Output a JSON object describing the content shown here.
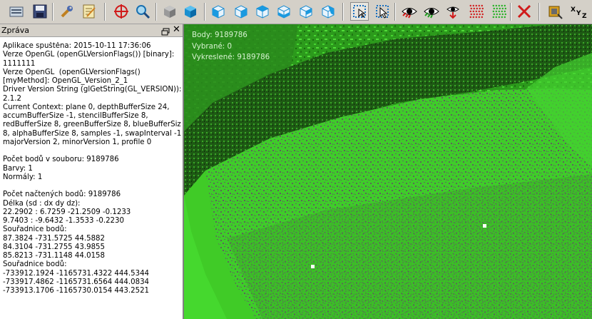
{
  "toolbar": {
    "buttons": [
      {
        "name": "open-file-icon"
      },
      {
        "name": "save-file-icon"
      },
      {
        "name": "settings-wrench-icon"
      },
      {
        "name": "edit-notes-icon"
      },
      {
        "name": "target-icon"
      },
      {
        "name": "zoom-icon"
      },
      {
        "name": "gray-cube-icon"
      },
      {
        "name": "blue-cube-icon"
      },
      {
        "name": "view-front-icon"
      },
      {
        "name": "view-back-icon"
      },
      {
        "name": "view-left-icon"
      },
      {
        "name": "view-right-icon"
      },
      {
        "name": "view-top-icon"
      },
      {
        "name": "view-bottom-icon"
      },
      {
        "name": "rect-select-icon"
      },
      {
        "name": "pointer-select-icon"
      },
      {
        "name": "show-red-eye-icon"
      },
      {
        "name": "show-green-eye-icon"
      },
      {
        "name": "eye-down-icon"
      },
      {
        "name": "red-points-icon"
      },
      {
        "name": "green-points-icon"
      },
      {
        "name": "clear-x-icon"
      },
      {
        "name": "measure-icon"
      },
      {
        "name": "xyz-axes-icon"
      }
    ],
    "xyz_label": "XYZ"
  },
  "panel": {
    "title": "Zpráva",
    "close_symbol": "✕",
    "log_lines": [
      "Aplikace spuštěna: 2015-10-11 17:36:06",
      "Verze OpenGL (openGLVersionFlags()) [binary]:",
      "1111111",
      "Verze OpenGL  (openGLVersionFlags()",
      "[myMethod]: OpenGL_Version_2_1",
      "Driver Version String (glGetString(GL_VERSION)):",
      "2.1.2",
      "Current Context: plane 0, depthBufferSize 24,",
      "accumBufferSize -1, stencilBufferSize 8,",
      "redBufferSize 8, greenBufferSize 8, blueBufferSize",
      "8, alphaBufferSize 8, samples -1, swapInterval -1,",
      "majorVersion 2, minorVersion 1, profile 0",
      "",
      "Počet bodů v souboru: 9189786",
      "Barvy: 1",
      "Normály: 1",
      "",
      "Počet načtených bodů: 9189786",
      "Délka (sd : dx dy dz):",
      "22.2902 : 6.7259 -21.2509 -0.1233",
      "9.7403 : -9.6432 -1.3533 -0.2230",
      "Souřadnice bodů:",
      "87.3824 -731.5725 44.5882",
      "84.3104 -731.2755 43.9855",
      "85.8213 -731.1148 44.0158",
      "Souřadnice bodů:",
      "-733912.1924 -1165731.4322 444.5344",
      "-733917.4862 -1165731.6564 444.0834",
      "-733913.1706 -1165730.0154 443.2521"
    ]
  },
  "viewport": {
    "stats": {
      "points": "Body: 9189786",
      "selected": "Vybrané: 0",
      "drawn": "Vykreslené: 9189786"
    }
  },
  "colors": {
    "point_green": "#3fd02a",
    "point_dark_green": "#1f6b14",
    "ground_gray": "#5a5a5a",
    "accent_red": "#d01a1a",
    "accent_blue": "#1aa0e0"
  }
}
